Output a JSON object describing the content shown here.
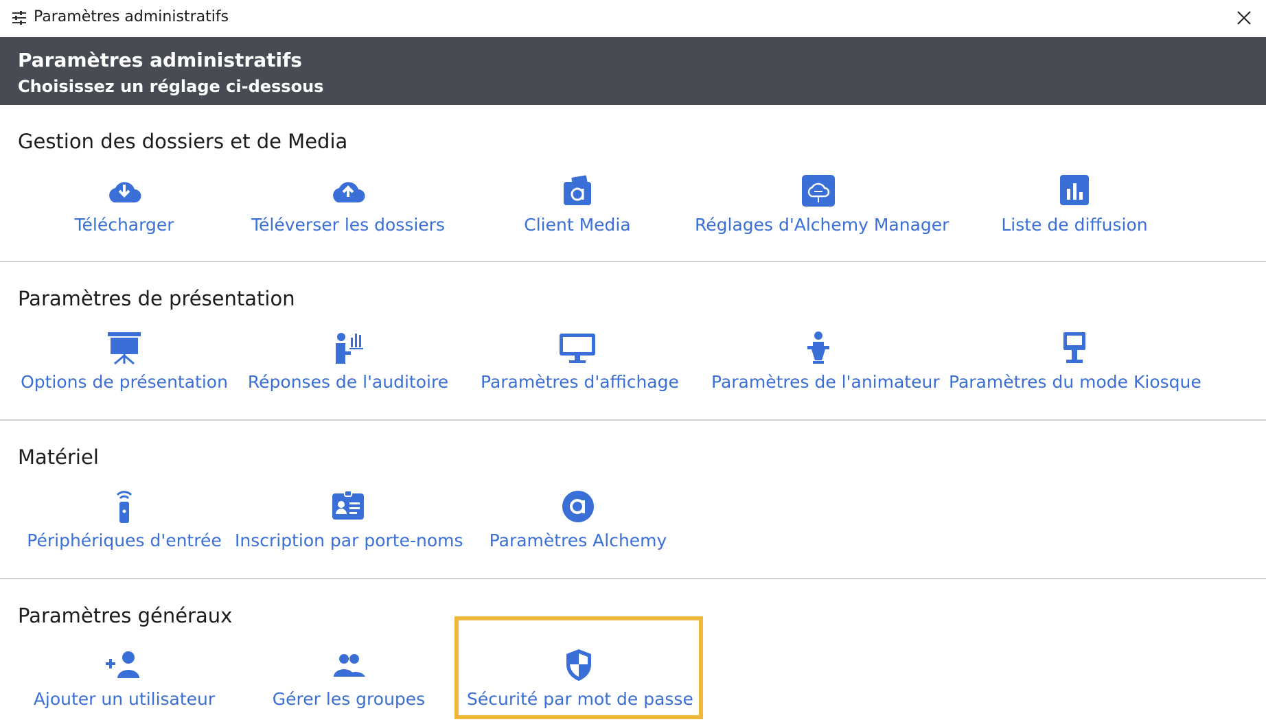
{
  "window": {
    "title": "Paramètres administratifs",
    "icon": "settings-sliders-icon",
    "close_icon": "close-icon"
  },
  "header": {
    "title": "Paramètres administratifs",
    "subtitle": "Choisissez un réglage ci-dessous"
  },
  "colors": {
    "accent": "#3a6fd8",
    "header_bg": "#474c54",
    "highlight": "#f0b83b"
  },
  "sections": [
    {
      "title": "Gestion des dossiers et de Media",
      "items": [
        {
          "label": "Télécharger",
          "icon": "cloud-download-icon"
        },
        {
          "label": "Téléverser les dossiers",
          "icon": "cloud-upload-icon"
        },
        {
          "label": "Client Media",
          "icon": "media-client-icon"
        },
        {
          "label": "Réglages d'Alchemy Manager",
          "icon": "cloud-settings-icon"
        },
        {
          "label": "Liste de diffusion",
          "icon": "bar-chart-icon"
        }
      ]
    },
    {
      "title": "Paramètres de présentation",
      "items": [
        {
          "label": "Options de présentation",
          "icon": "presentation-board-icon"
        },
        {
          "label": "Réponses de l'auditoire",
          "icon": "audience-responses-icon"
        },
        {
          "label": "Paramètres d'affichage",
          "icon": "monitor-icon"
        },
        {
          "label": "Paramètres de l'animateur",
          "icon": "presenter-icon"
        },
        {
          "label": "Paramètres du mode Kiosque",
          "icon": "kiosk-icon"
        }
      ]
    },
    {
      "title": "Matériel",
      "items": [
        {
          "label": "Périphériques d'entrée",
          "icon": "remote-clicker-icon"
        },
        {
          "label": "Inscription par porte-noms",
          "icon": "badge-icon"
        },
        {
          "label": "Paramètres Alchemy",
          "icon": "alchemy-logo-icon"
        }
      ]
    },
    {
      "title": "Paramètres généraux",
      "items": [
        {
          "label": "Ajouter un utilisateur",
          "icon": "add-user-icon"
        },
        {
          "label": "Gérer les groupes",
          "icon": "group-icon"
        },
        {
          "label": "Sécurité par mot de passe",
          "icon": "shield-icon"
        }
      ]
    }
  ]
}
